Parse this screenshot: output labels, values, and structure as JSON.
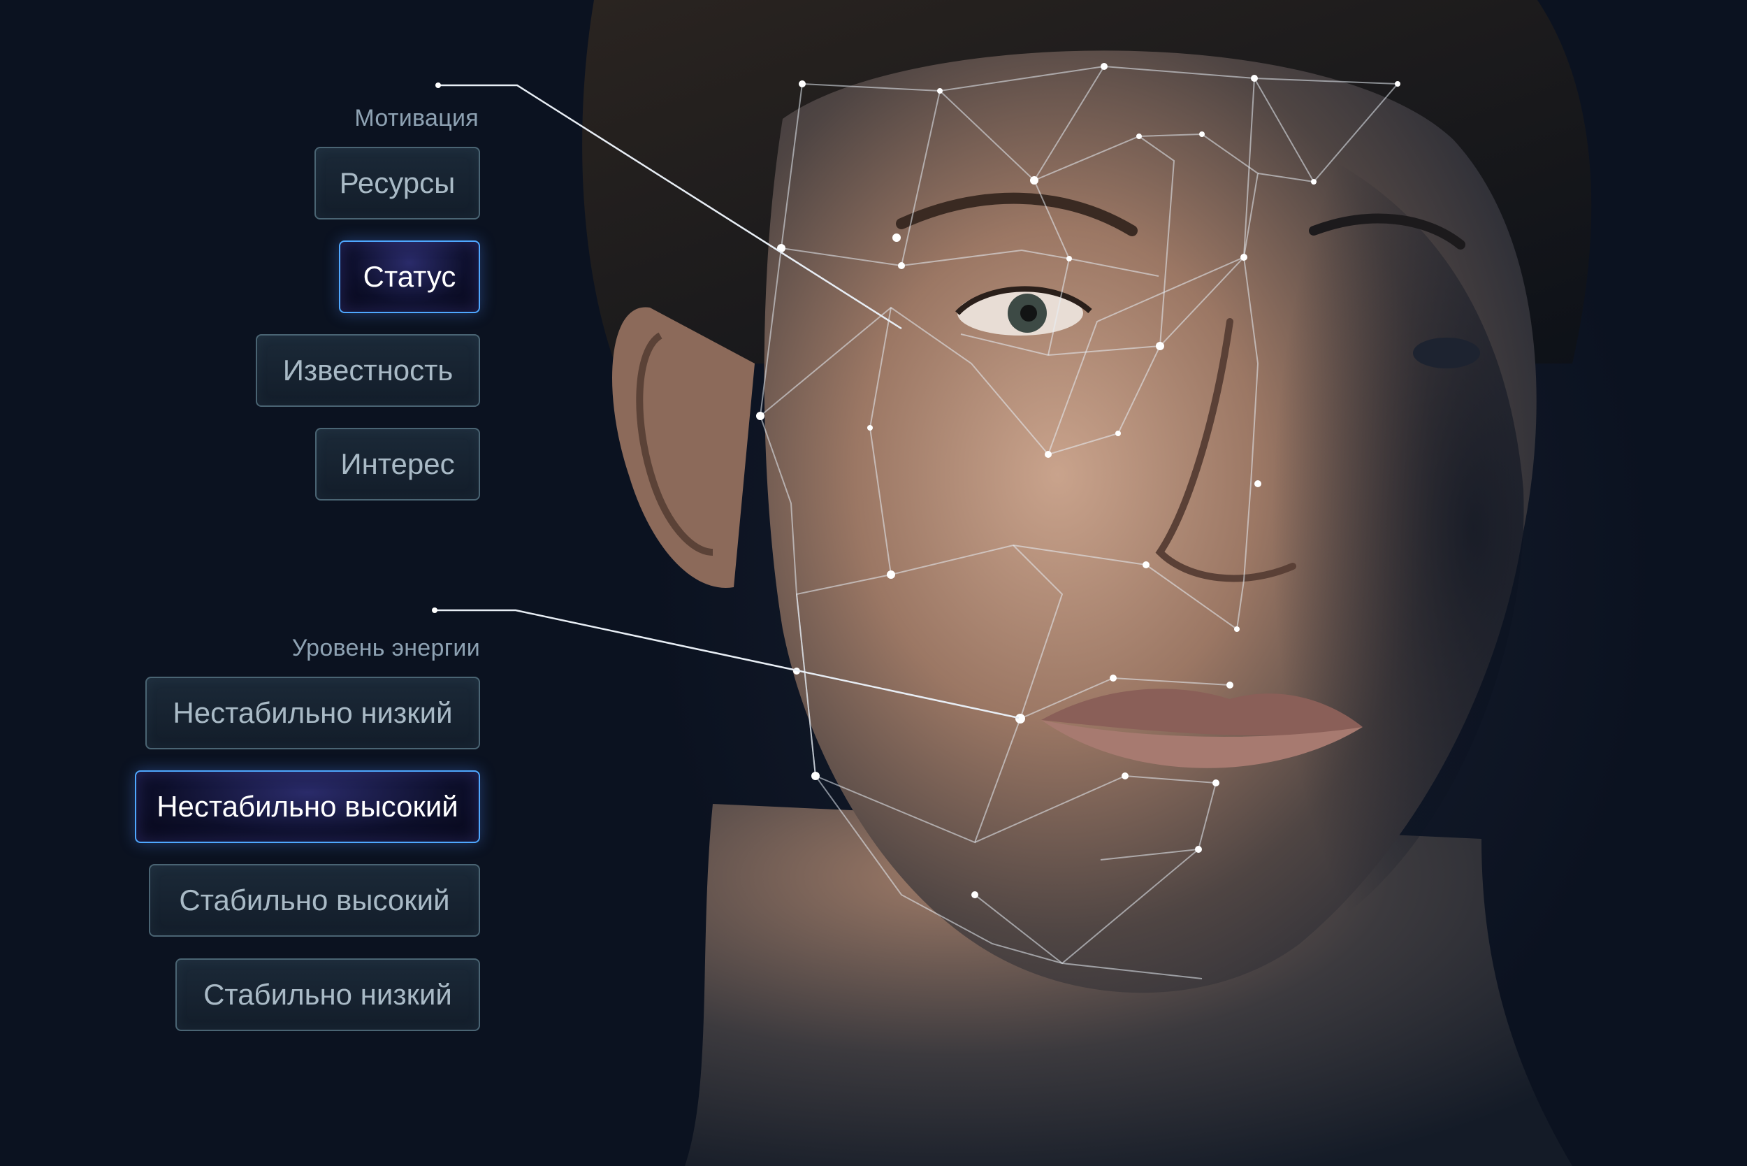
{
  "motivation": {
    "label": "Мотивация",
    "options": [
      {
        "label": "Ресурсы",
        "selected": false
      },
      {
        "label": "Статус",
        "selected": true
      },
      {
        "label": "Известность",
        "selected": false
      },
      {
        "label": "Интерес",
        "selected": false
      }
    ]
  },
  "energy": {
    "label": "Уровень энергии",
    "options": [
      {
        "label": "Нестабильно низкий",
        "selected": false
      },
      {
        "label": "Нестабильно высокий",
        "selected": true
      },
      {
        "label": "Стабильно высокий",
        "selected": false
      },
      {
        "label": "Стабильно низкий",
        "selected": false
      }
    ]
  },
  "colors": {
    "background": "#0b1220",
    "option_border": "#4a6473",
    "selected_border": "#4fa8ff",
    "selected_fill": "#0d0f2a",
    "mesh_line": "#e8eef5"
  }
}
